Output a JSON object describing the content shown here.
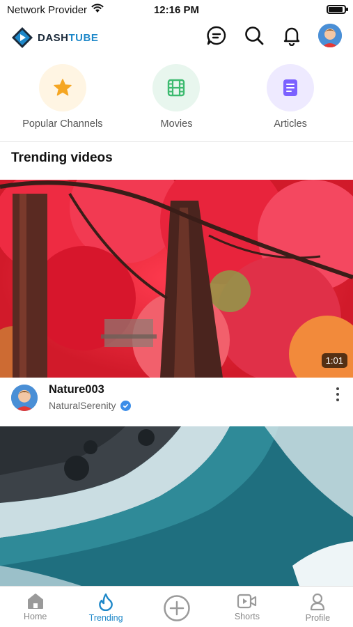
{
  "status_bar": {
    "carrier": "Network Provider",
    "time": "12:16 PM",
    "battery_level": 0.9
  },
  "header": {
    "logo_part1": "DASH",
    "logo_part2": "TUBE",
    "icons": [
      "chat-icon",
      "search-icon",
      "bell-icon",
      "avatar"
    ],
    "brand_color": "#1e88c9"
  },
  "categories": [
    {
      "label": "Popular Channels",
      "icon": "star-icon",
      "bg": "#fff5e3",
      "color": "#f5a623"
    },
    {
      "label": "Movies",
      "icon": "film-icon",
      "bg": "#e8f6ee",
      "color": "#3cba6f"
    },
    {
      "label": "Articles",
      "icon": "article-icon",
      "bg": "#eeeaff",
      "color": "#7b61ff"
    }
  ],
  "section_title": "Trending videos",
  "videos": [
    {
      "duration": "1:01",
      "title": "Nature003",
      "channel": "NaturalSerenity",
      "verified": true
    }
  ],
  "bottom_nav": [
    {
      "label": "Home",
      "icon": "home-icon",
      "active": false
    },
    {
      "label": "Trending",
      "icon": "flame-icon",
      "active": true
    },
    {
      "label": "",
      "icon": "add-circle-icon",
      "active": false
    },
    {
      "label": "Shorts",
      "icon": "video-icon",
      "active": false
    },
    {
      "label": "Profile",
      "icon": "person-icon",
      "active": false
    }
  ]
}
